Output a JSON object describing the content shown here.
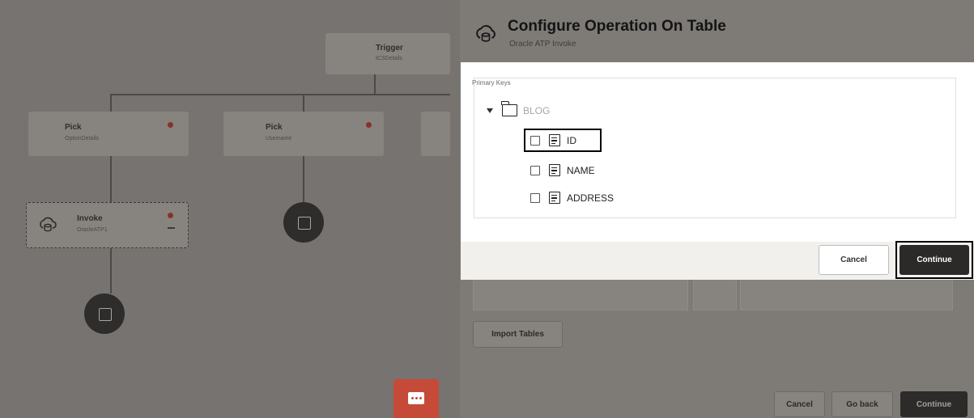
{
  "canvas": {
    "trigger": {
      "title": "Trigger",
      "subtitle": "ICSDetails"
    },
    "pick_left": {
      "title": "Pick",
      "subtitle": "OptionDetails"
    },
    "pick_mid": {
      "title": "Pick",
      "subtitle": "Username"
    },
    "invoke": {
      "title": "Invoke",
      "subtitle": "OracleATP1"
    }
  },
  "panel": {
    "title": "Configure Operation On Table",
    "subtitle": "Oracle ATP Invoke",
    "import_label": "Import Tables",
    "footer": {
      "cancel": "Cancel",
      "go_back": "Go back",
      "continue": "Continue"
    }
  },
  "dialog": {
    "primary_keys_label": "Primary Keys",
    "table_name": "BLOG",
    "columns": [
      "ID",
      "NAME",
      "ADDRESS"
    ],
    "cancel": "Cancel",
    "continue": "Continue"
  },
  "icons": {
    "header": "cloud-db-icon",
    "tree_toggle": "caret-down-icon",
    "table": "folder-icon",
    "column": "column-icon",
    "feedback": "chat-icon"
  },
  "colors": {
    "primary_button": "#2b2a28",
    "feedback_button": "#c64a38",
    "overlay": "#7e7b77",
    "error_dot": "#8c2f2a"
  }
}
